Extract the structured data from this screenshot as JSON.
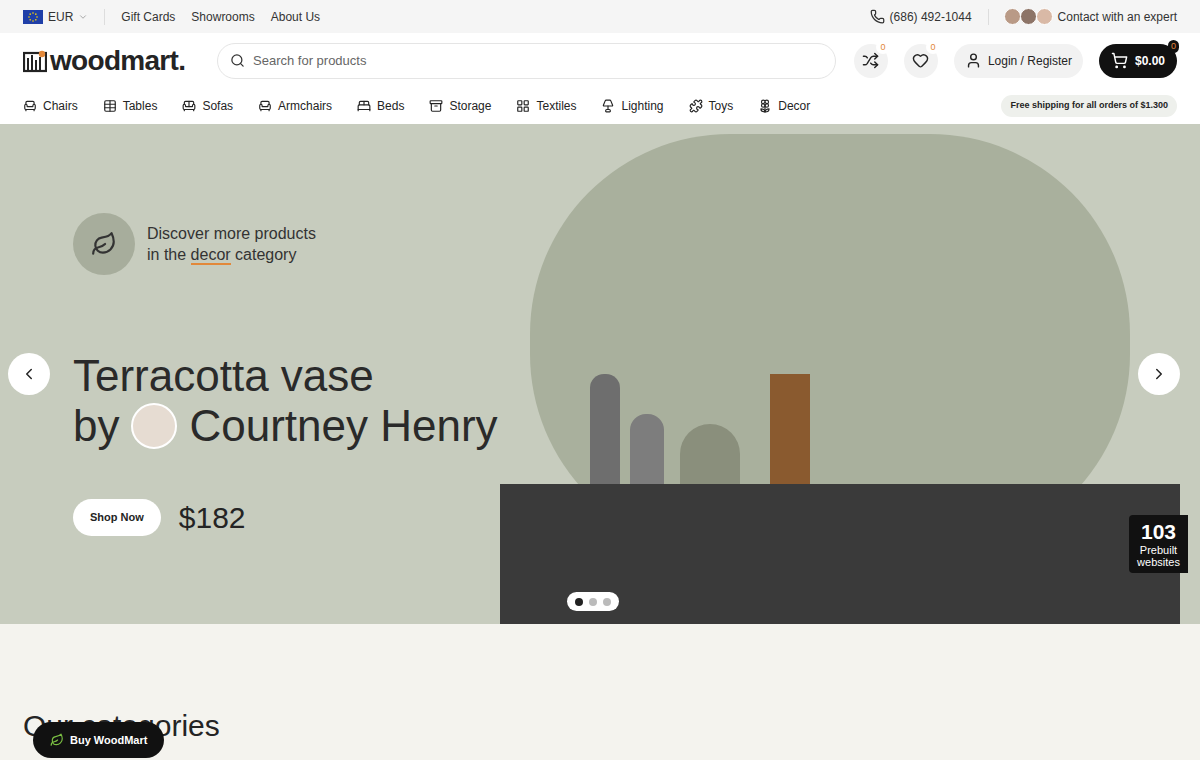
{
  "topbar": {
    "currency": "EUR",
    "links": [
      "Gift Cards",
      "Showrooms",
      "About Us"
    ],
    "phone": "(686) 492-1044",
    "contact": "Contact with an expert"
  },
  "header": {
    "logo": "woodmart.",
    "search": {
      "placeholder": "Search for products"
    },
    "compare_count": "0",
    "wishlist_count": "0",
    "login": "Login / Register",
    "cart_total": "$0.00",
    "cart_count": "0"
  },
  "nav": {
    "items": [
      "Chairs",
      "Tables",
      "Sofas",
      "Armchairs",
      "Beds",
      "Storage",
      "Textiles",
      "Lighting",
      "Toys",
      "Decor"
    ],
    "shipping": "Free shipping for all orders of $1.300"
  },
  "hero": {
    "promo": {
      "line1": "Discover more products",
      "before": "in the",
      "link": "decor",
      "after": "category"
    },
    "title": "Terracotta vase",
    "by": "by",
    "author": "Courtney Henry",
    "button": "Shop Now",
    "price": "$182",
    "slides": [
      {
        "selected": true
      },
      {
        "selected": false
      },
      {
        "selected": false
      }
    ]
  },
  "badge": {
    "count": "103",
    "label": "Prebuilt websites"
  },
  "section": {
    "heading": "Our categories"
  },
  "buy_button": "Buy WoodMart"
}
